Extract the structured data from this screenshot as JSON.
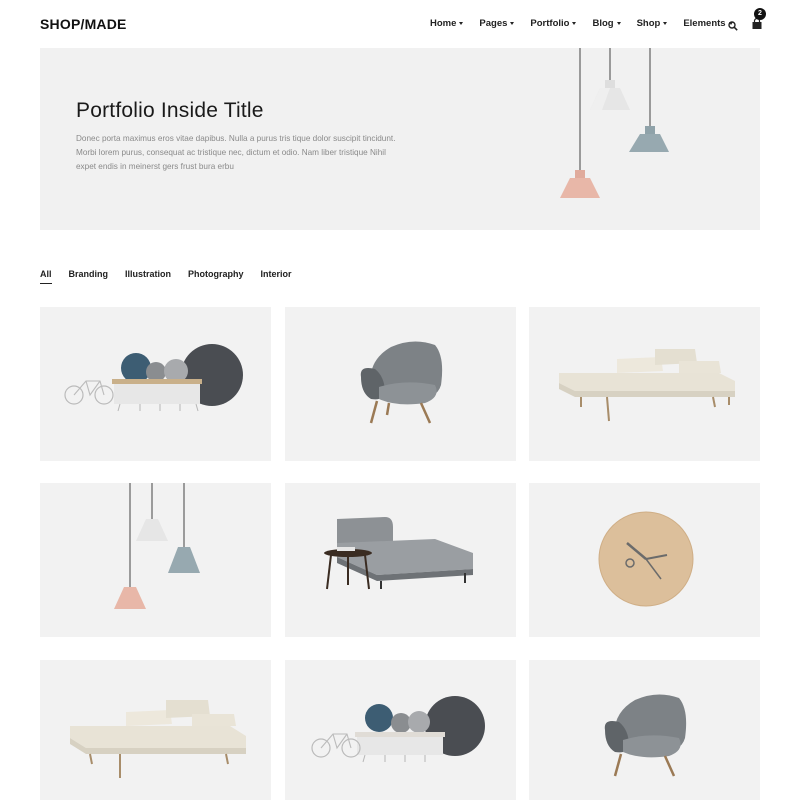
{
  "header": {
    "logo": "SHOP/MADE",
    "nav": [
      {
        "label": "Home"
      },
      {
        "label": "Pages"
      },
      {
        "label": "Portfolio"
      },
      {
        "label": "Blog"
      },
      {
        "label": "Shop"
      },
      {
        "label": "Elements"
      }
    ],
    "cart_count": "2",
    "icons": {
      "search": "search-icon",
      "cart": "shopping-bag-icon"
    }
  },
  "hero": {
    "title": "Portfolio Inside Title",
    "text": "Donec porta maximus eros vitae dapibus. Nulla a purus tris tique dolor suscipit tincidunt. Morbi lorem purus, consequat ac tristique nec, dictum et odio. Nam liber tristique Nihil expet endis in meinerst gers frust bura erbu"
  },
  "filters": {
    "active": "All",
    "items": [
      {
        "label": "All"
      },
      {
        "label": "Branding"
      },
      {
        "label": "Illustration"
      },
      {
        "label": "Photography"
      },
      {
        "label": "Interior"
      }
    ]
  },
  "portfolio": {
    "items": [
      {
        "image": "bicycle-table-circles"
      },
      {
        "image": "grey-armchair"
      },
      {
        "image": "cream-daybed"
      },
      {
        "image": "pendant-lamps"
      },
      {
        "image": "grey-chaise-lounge"
      },
      {
        "image": "wooden-wall-clock"
      },
      {
        "image": "cream-daybed"
      },
      {
        "image": "bicycle-table-circles"
      },
      {
        "image": "grey-armchair"
      }
    ]
  },
  "colors": {
    "background": "#ffffff",
    "hero_bg": "#f1f1f1",
    "tile_bg": "#f2f2f2",
    "text_dark": "#222222",
    "text_muted": "#8a8a8a",
    "lamp_white": "#e4e4e4",
    "lamp_blue": "#97a9b0",
    "lamp_pink": "#e8b7a8"
  }
}
